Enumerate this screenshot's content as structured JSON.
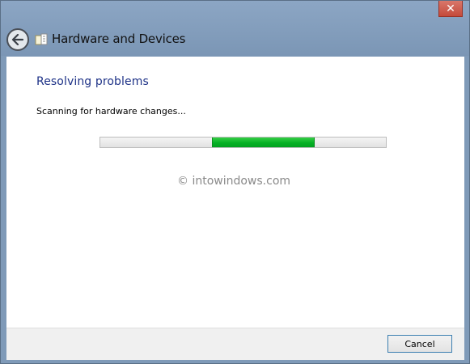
{
  "window": {
    "title": "Hardware and Devices",
    "close_label": "✕"
  },
  "main": {
    "heading": "Resolving problems",
    "status": "Scanning for hardware changes...",
    "watermark": "© intowindows.com"
  },
  "progress": {
    "mode": "indeterminate",
    "chunk_start_fraction": 0.39,
    "chunk_end_fraction": 0.75
  },
  "footer": {
    "cancel_label": "Cancel"
  },
  "colors": {
    "heading": "#1e3287",
    "progress_fill": "#06b025",
    "titlebar": "#7f9ab8"
  }
}
